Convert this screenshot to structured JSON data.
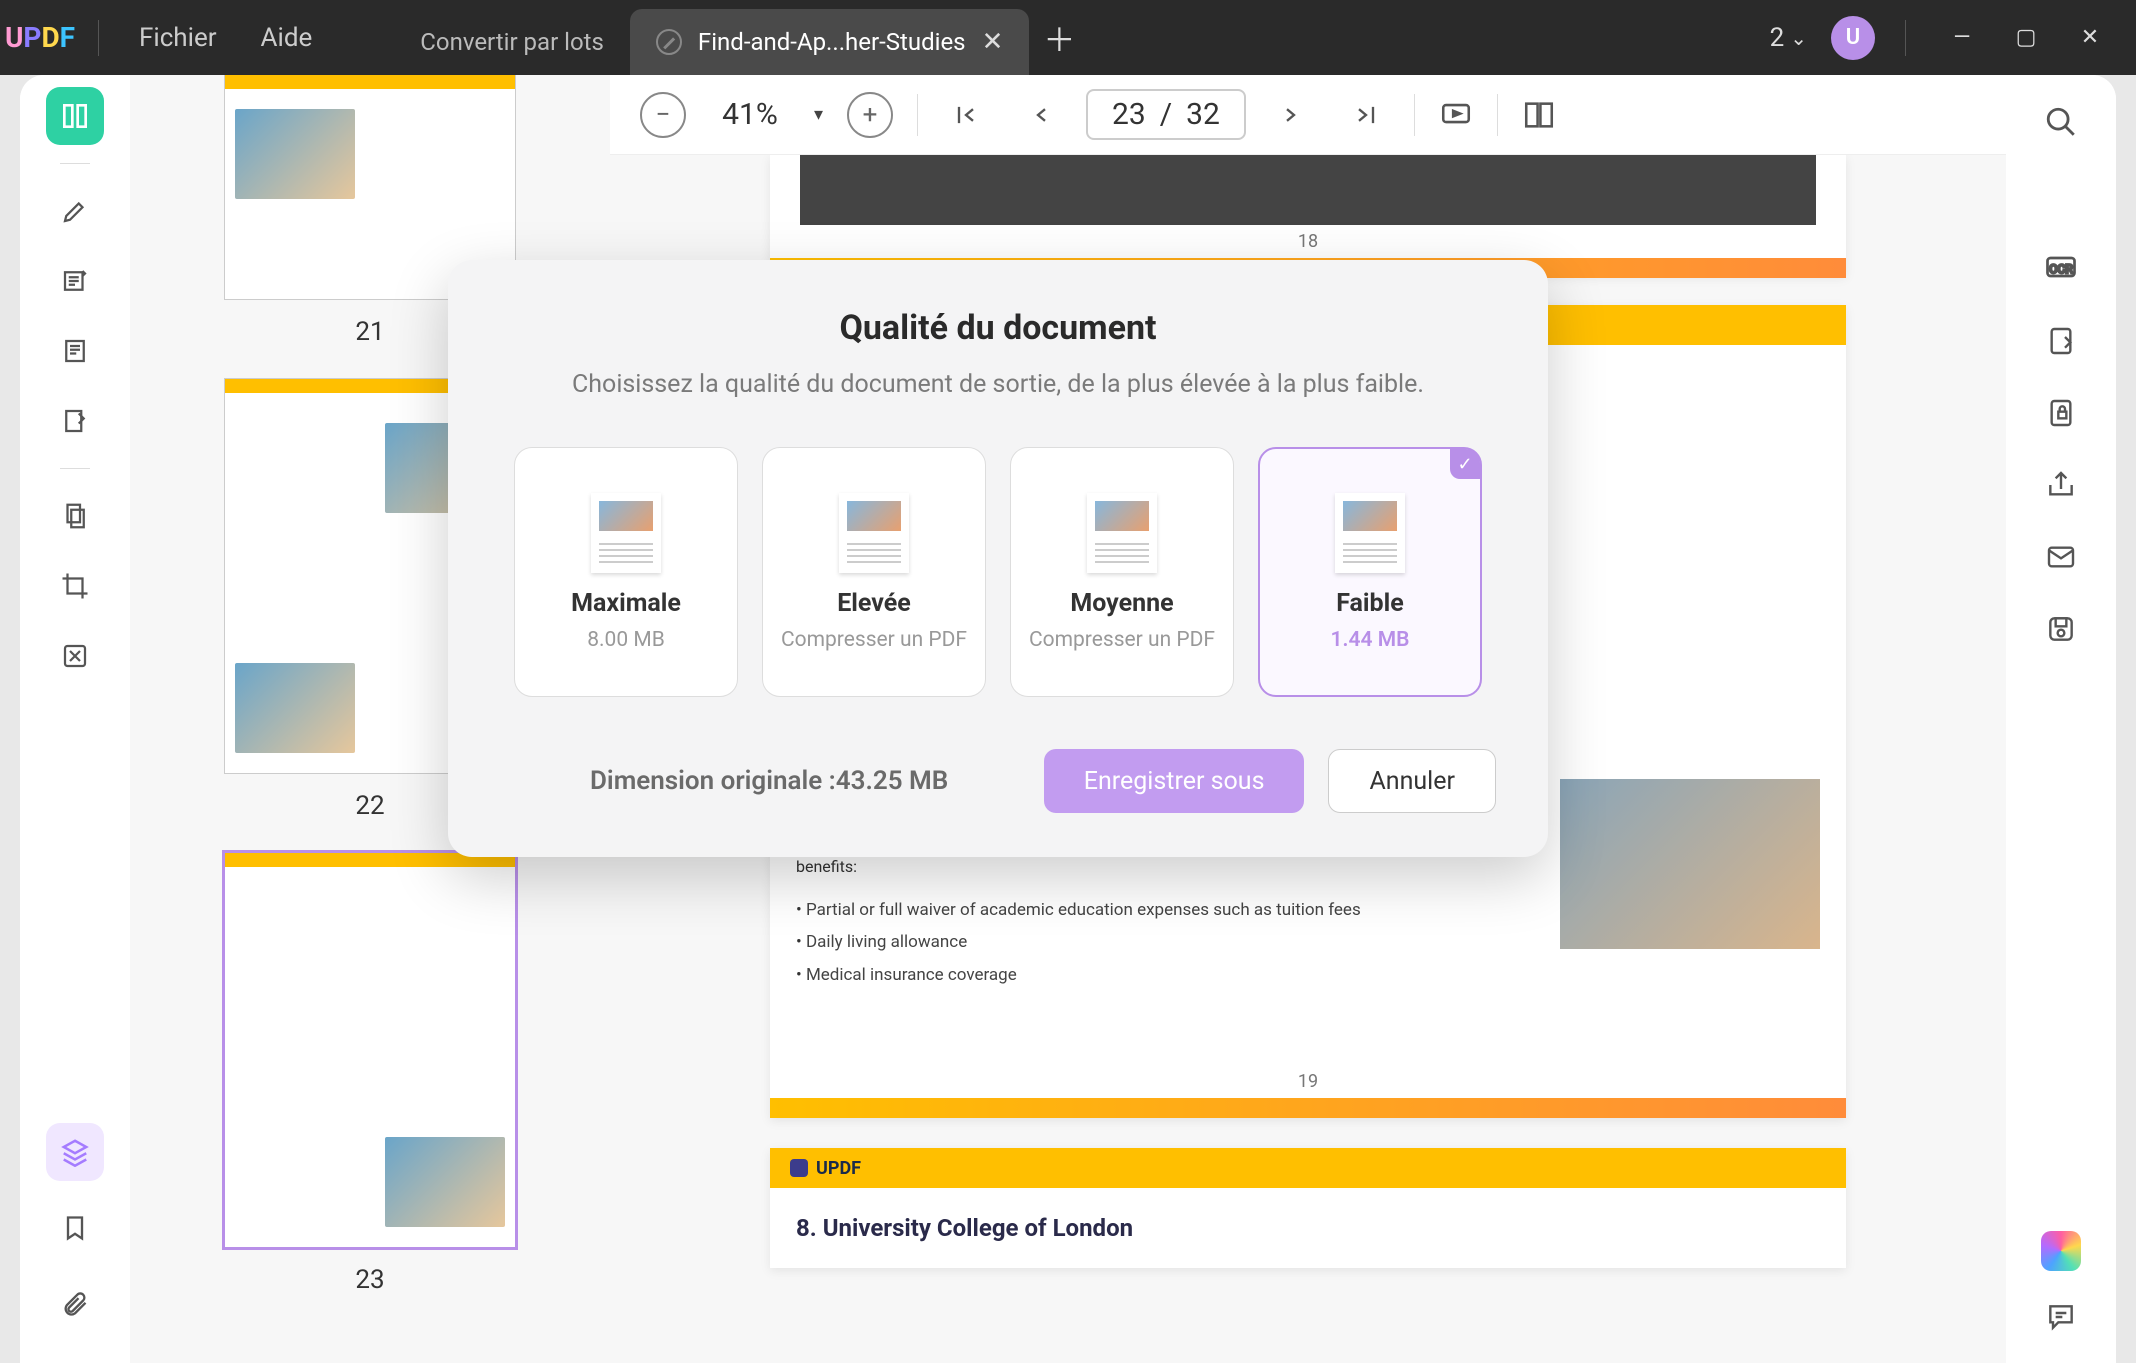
{
  "titlebar": {
    "logo": "UPDF",
    "menu": {
      "file": "Fichier",
      "help": "Aide"
    },
    "tab_convert": "Convertir par lots",
    "tab_active": "Find-and-Ap...her-Studies",
    "doc_count": "2",
    "avatar_letter": "U"
  },
  "toolbar": {
    "zoom": "41%",
    "page_current": "23",
    "page_total": "32"
  },
  "thumbnails": {
    "p21": "21",
    "p22": "22",
    "p23": "23"
  },
  "document": {
    "page18_num": "18",
    "page19_num": "19",
    "brand": "UPDF",
    "body_line": "requirements, a successful applicant can expect the following general funding benefits:",
    "b1": "Partial or full waiver of academic education expenses such as tuition fees",
    "b2": "Daily living allowance",
    "b3": "Medical insurance coverage",
    "heading8": "8. University College of London"
  },
  "modal": {
    "title": "Qualité du document",
    "subtitle": "Choisissez la qualité du document de sortie, de la plus élevée à la plus faible.",
    "q_max": "Maximale",
    "q_max_size": "8.00 MB",
    "q_high": "Elevée",
    "q_high_sub": "Compresser un PDF",
    "q_med": "Moyenne",
    "q_med_sub": "Compresser un PDF",
    "q_low": "Faible",
    "q_low_size": "1.44 MB",
    "original": "Dimension originale :43.25 MB",
    "save_as": "Enregistrer sous",
    "cancel": "Annuler"
  }
}
